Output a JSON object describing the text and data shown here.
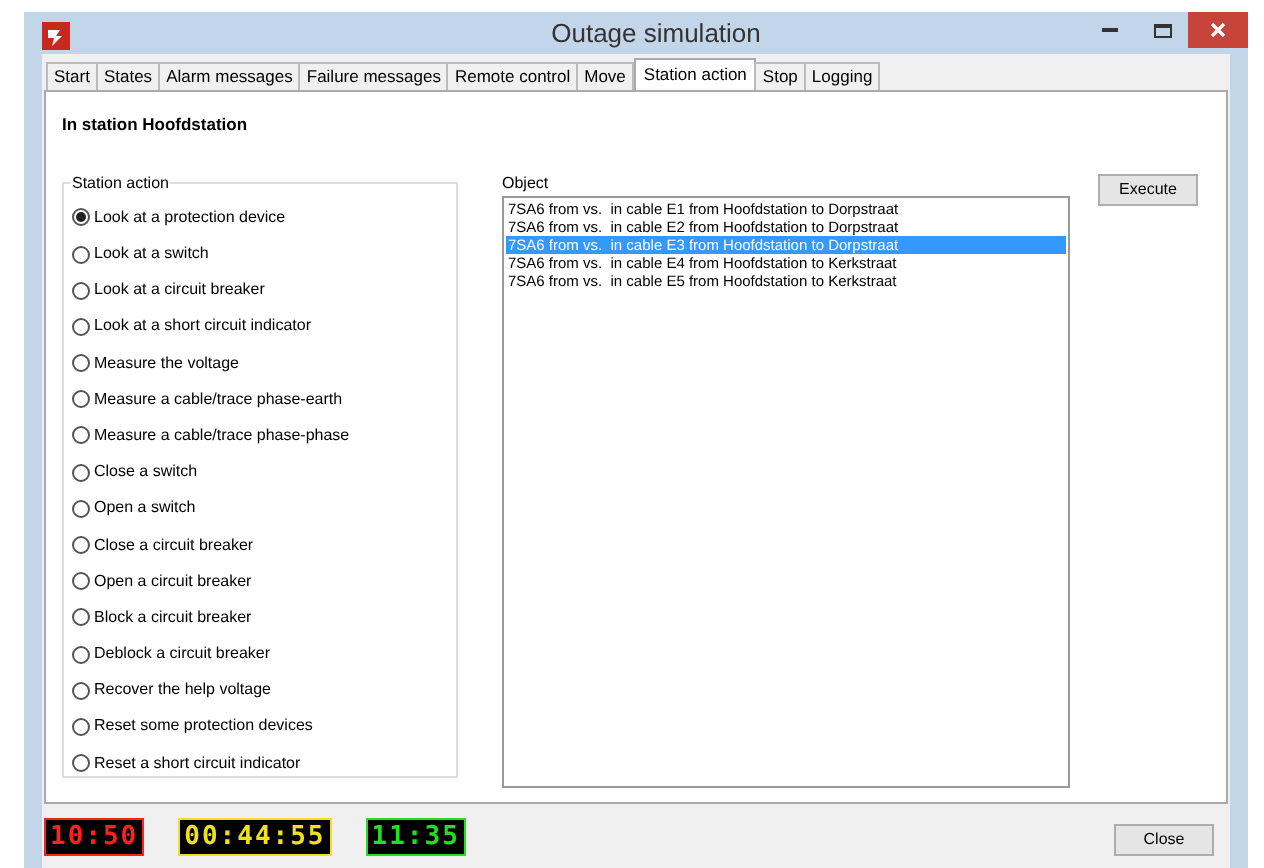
{
  "window": {
    "title": "Outage simulation"
  },
  "tabs": [
    {
      "label": "Start",
      "selected": false
    },
    {
      "label": "States",
      "selected": false
    },
    {
      "label": "Alarm messages",
      "selected": false
    },
    {
      "label": "Failure messages",
      "selected": false
    },
    {
      "label": "Remote control",
      "selected": false
    },
    {
      "label": "Move",
      "selected": false
    },
    {
      "label": "Station action",
      "selected": true
    },
    {
      "label": "Stop",
      "selected": false
    },
    {
      "label": "Logging",
      "selected": false
    }
  ],
  "heading": "In station Hoofdstation",
  "station_action": {
    "title": "Station action",
    "options": [
      {
        "label": "Look at a protection device",
        "selected": true
      },
      {
        "label": "Look at a switch",
        "selected": false
      },
      {
        "label": "Look at a circuit breaker",
        "selected": false
      },
      {
        "label": "Look at a short circuit indicator",
        "selected": false
      },
      {
        "label": "Measure the voltage",
        "selected": false
      },
      {
        "label": "Measure a cable/trace phase-earth",
        "selected": false
      },
      {
        "label": "Measure a cable/trace phase-phase",
        "selected": false
      },
      {
        "label": "Close a switch",
        "selected": false
      },
      {
        "label": "Open a switch",
        "selected": false
      },
      {
        "label": "Close a circuit breaker",
        "selected": false
      },
      {
        "label": "Open a circuit breaker",
        "selected": false
      },
      {
        "label": "Block a circuit breaker",
        "selected": false
      },
      {
        "label": "Deblock a circuit breaker",
        "selected": false
      },
      {
        "label": "Recover the help voltage",
        "selected": false
      },
      {
        "label": "Reset some protection devices",
        "selected": false
      },
      {
        "label": "Reset a short circuit indicator",
        "selected": false
      }
    ]
  },
  "object": {
    "label": "Object",
    "items": [
      {
        "label": "7SA6 from vs.  in cable E1 from Hoofdstation to Dorpstraat",
        "selected": false
      },
      {
        "label": "7SA6 from vs.  in cable E2 from Hoofdstation to Dorpstraat",
        "selected": false
      },
      {
        "label": "7SA6 from vs.  in cable E3 from Hoofdstation to Dorpstraat",
        "selected": true
      },
      {
        "label": "7SA6 from vs.  in cable E4 from Hoofdstation to Kerkstraat",
        "selected": false
      },
      {
        "label": "7SA6 from vs.  in cable E5 from Hoofdstation to Kerkstraat",
        "selected": false
      }
    ]
  },
  "execute_button": "Execute",
  "clocks": [
    {
      "time": "10:50",
      "color": "#ff2020"
    },
    {
      "time": "00:44:55",
      "color": "#f0e020"
    },
    {
      "time": "11:35",
      "color": "#20e020"
    }
  ],
  "close_button": "Close"
}
